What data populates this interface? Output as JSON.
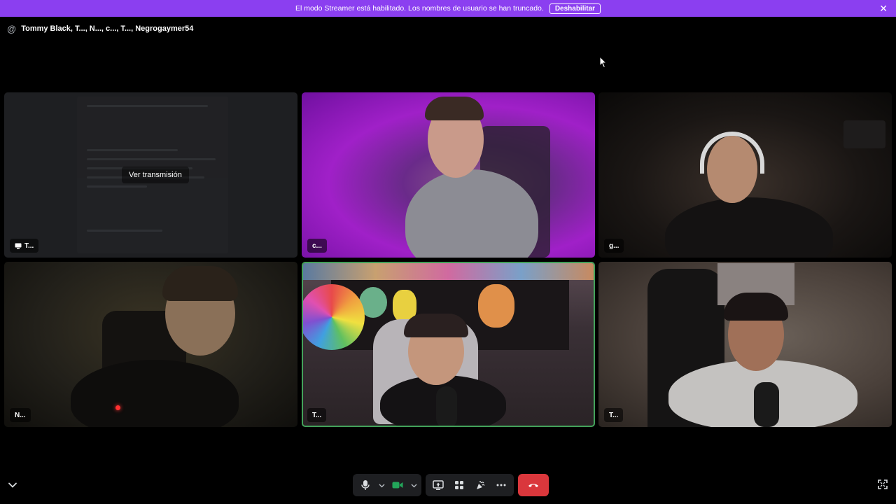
{
  "banner": {
    "message": "El modo Streamer está habilitado. Los nombres de usuario se han truncado.",
    "disable_label": "Deshabilitar",
    "background": "#8b3ff0"
  },
  "header": {
    "icon": "at-icon",
    "title": "Tommy Black, T..., N..., c..., T..., Negrogaymer54"
  },
  "tiles": [
    {
      "name": "T...",
      "type": "screen-share",
      "overlay_label": "Ver transmisión",
      "icon": "screen-share-icon"
    },
    {
      "name": "c...",
      "type": "camera"
    },
    {
      "name": "g...",
      "type": "camera"
    },
    {
      "name": "N...",
      "type": "camera"
    },
    {
      "name": "T...",
      "type": "camera",
      "speaking": true,
      "highlight": "#43a25a"
    },
    {
      "name": "T...",
      "type": "camera"
    }
  ],
  "controls": {
    "mic_icon": "microphone-icon",
    "camera_icon": "video-camera-icon",
    "camera_active_color": "#23a55a",
    "share_icon": "screen-share-icon",
    "activities_icon": "activities-icon",
    "soundboard_icon": "soundboard-icon",
    "more_icon": "more-icon",
    "hangup_icon": "hang-up-icon",
    "hangup_color": "#da373c"
  }
}
